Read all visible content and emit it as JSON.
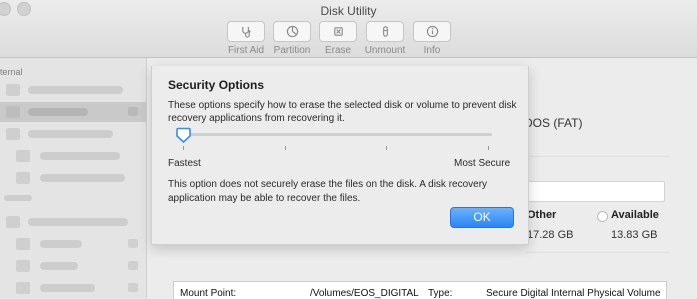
{
  "window": {
    "title": "Disk Utility"
  },
  "toolbar": {
    "first_aid": "First Aid",
    "partition": "Partition",
    "erase": "Erase",
    "unmount": "Unmount",
    "info": "Info"
  },
  "sidebar": {
    "section_internal": "ternal",
    "section_external": ""
  },
  "main": {
    "format_text": "DOS (FAT)",
    "legend": [
      {
        "title": "Other",
        "value": "17.28 GB"
      },
      {
        "title": "Available",
        "value": "13.83 GB"
      }
    ],
    "info": {
      "mount_point_label": "Mount Point:",
      "mount_point_value": "/Volumes/EOS_DIGITAL",
      "type_label": "Type:",
      "type_value": "Secure Digital Internal Physical Volume"
    }
  },
  "sheet": {
    "title": "Security Options",
    "description": "These options specify how to erase the selected disk or volume to prevent disk recovery applications from recovering it.",
    "slider": {
      "min_label": "Fastest",
      "max_label": "Most Secure",
      "level": 0,
      "steps": 4
    },
    "note": "This option does not securely erase the files on the disk. A disk recovery application may be able to recover the files.",
    "ok_label": "OK"
  },
  "colors": {
    "accent": "#2b85f5",
    "slider_thumb": "#3b8cf0"
  }
}
